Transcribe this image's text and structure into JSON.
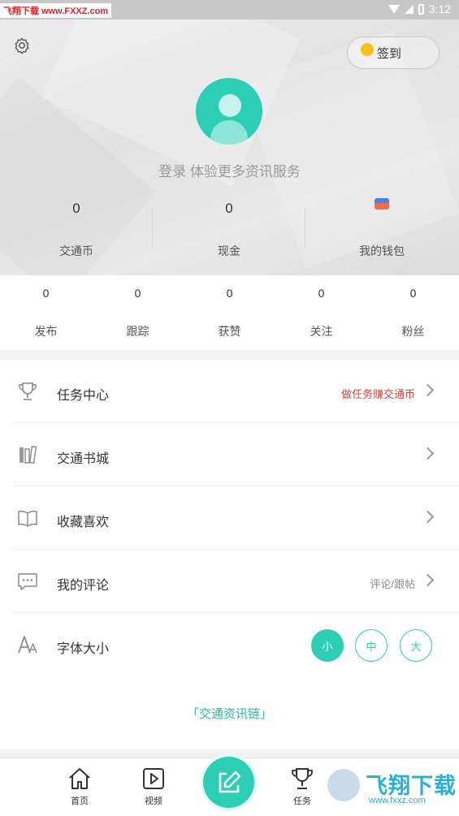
{
  "status_bar": {
    "watermark": "飞翔下载 www.FXXZ.com",
    "time": "3:12"
  },
  "header": {
    "checkin_label": "签到",
    "login_prompt": "登录 体验更多资讯服务",
    "stats": [
      {
        "value": "0",
        "label": "交通币"
      },
      {
        "value": "0",
        "label": "现金"
      },
      {
        "value": "",
        "label": "我的钱包"
      }
    ]
  },
  "social": [
    {
      "value": "0",
      "label": "发布"
    },
    {
      "value": "0",
      "label": "跟踪"
    },
    {
      "value": "0",
      "label": "获赞"
    },
    {
      "value": "0",
      "label": "关注"
    },
    {
      "value": "0",
      "label": "粉丝"
    }
  ],
  "menu": {
    "items": [
      {
        "title": "任务中心",
        "hint": "做任务赚交通币",
        "icon": "trophy-icon"
      },
      {
        "title": "交通书城",
        "hint": "",
        "icon": "books-icon"
      },
      {
        "title": "收藏喜欢",
        "hint": "",
        "icon": "open-book-icon"
      },
      {
        "title": "我的评论",
        "hint": "评论/跟帖",
        "icon": "comment-icon"
      },
      {
        "title": "字体大小",
        "hint": "",
        "icon": "font-size-icon"
      }
    ],
    "font_sizes": [
      "小",
      "中",
      "大"
    ],
    "footer_link": "「交通资讯链」"
  },
  "tabbar": {
    "tabs": [
      {
        "label": "首页",
        "icon": "home-icon"
      },
      {
        "label": "视频",
        "icon": "video-icon"
      },
      {
        "label": "",
        "icon": "edit-icon"
      },
      {
        "label": "任务",
        "icon": "trophy-icon"
      }
    ]
  },
  "watermark_bottom": {
    "title": "飞翔下载",
    "url": "www.fxxz.com"
  },
  "colors": {
    "accent": "#2ccfb6",
    "red_hint": "#d9443a"
  }
}
